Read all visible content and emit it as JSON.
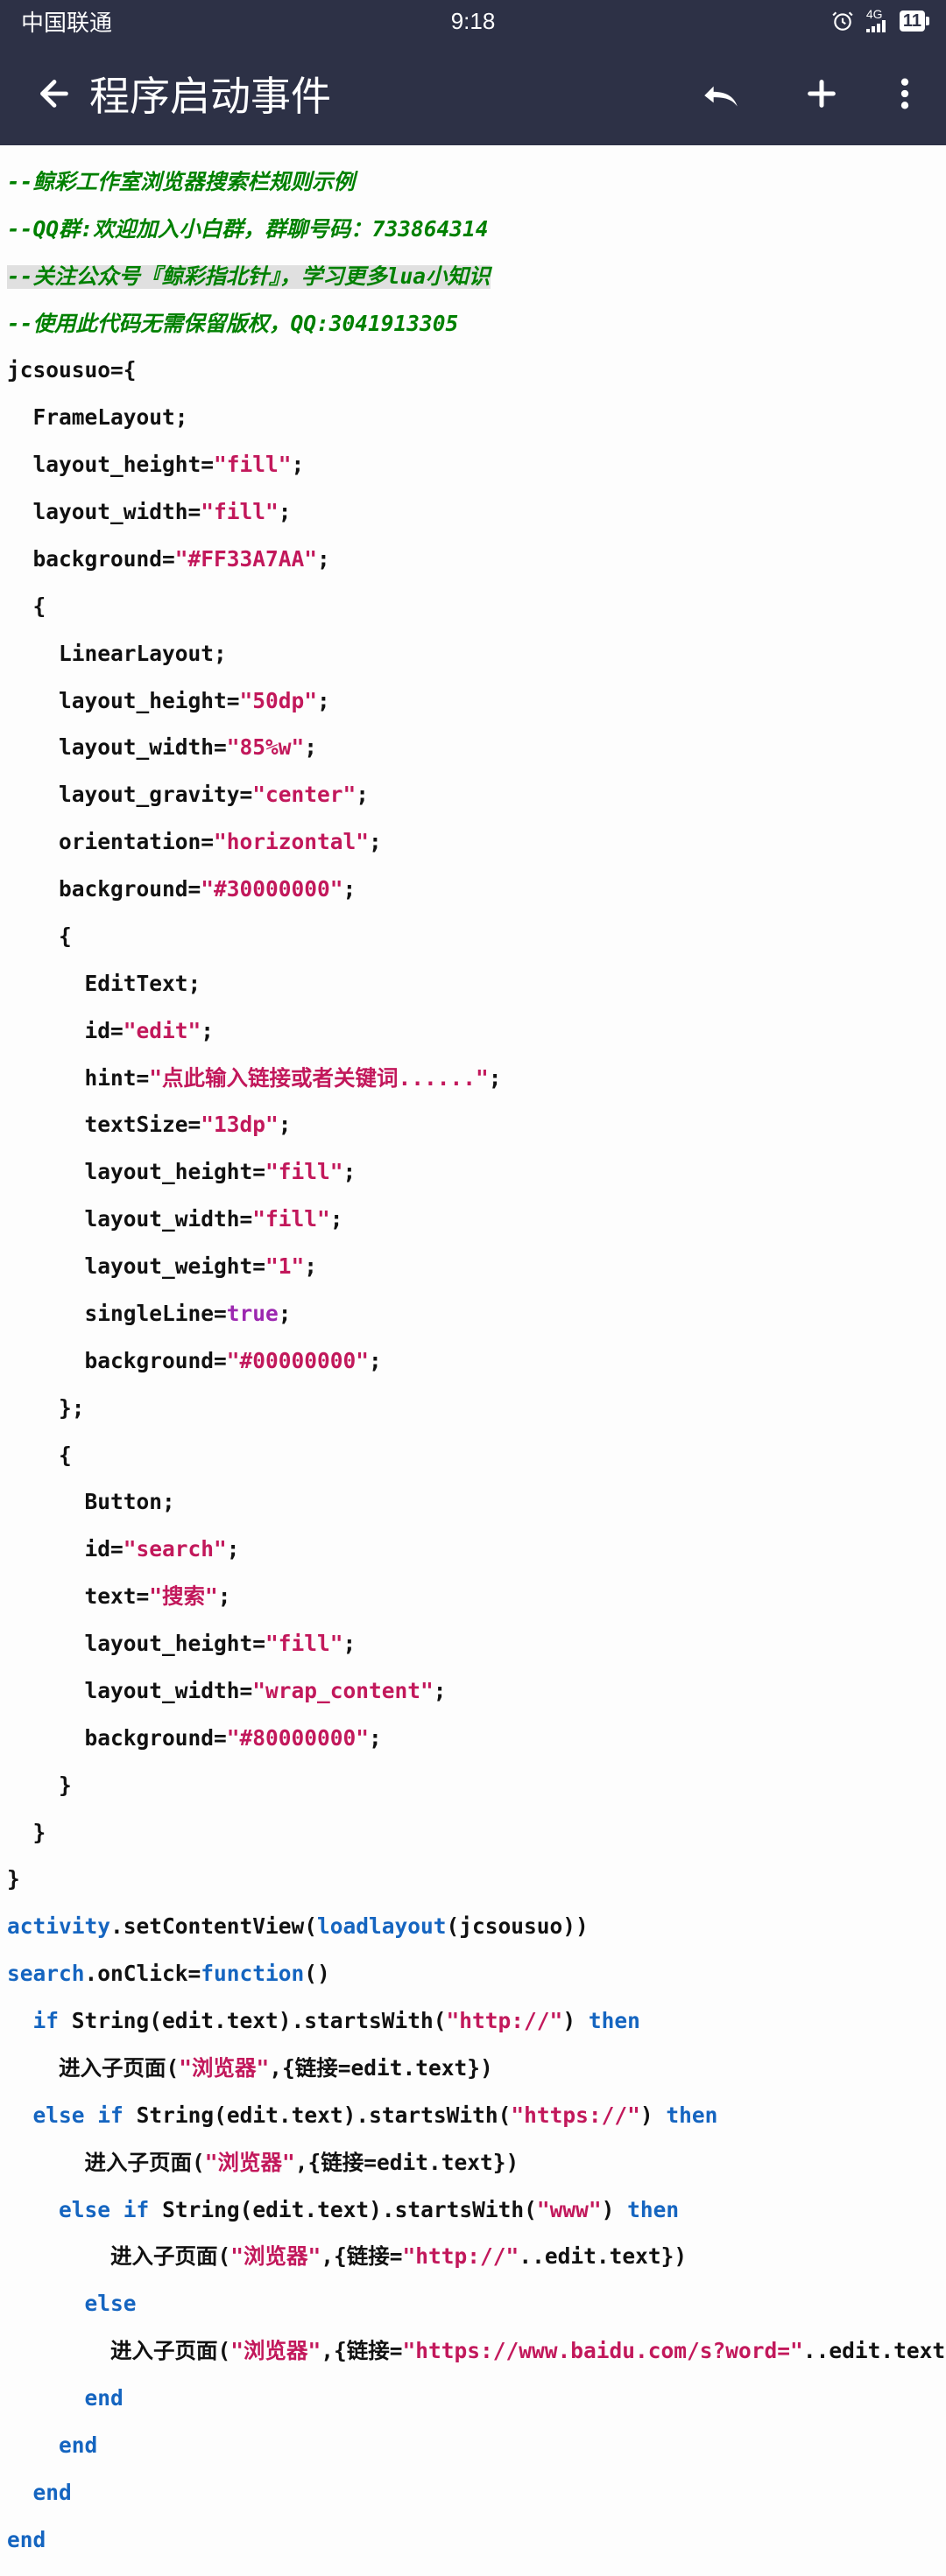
{
  "status": {
    "carrier": "中国联通",
    "time": "9:18",
    "network": "4G",
    "battery": "11"
  },
  "appbar": {
    "title": "程序启动事件"
  },
  "code": {
    "c1": "--鲸彩工作室浏览器搜索栏规则示例",
    "c2": "--QQ群:欢迎加入小白群，群聊号码：733864314",
    "c3": "--关注公众号『鲸彩指北针』，学习更多lua小知识",
    "c4": "--使用此代码无需保留版权，QQ:3041913305",
    "l1a": "jcsousuo={",
    "l2": "  FrameLayout;",
    "l3a": "  layout_height=",
    "l3b": "\"fill\"",
    "l3c": ";",
    "l4a": "  layout_width=",
    "l4b": "\"fill\"",
    "l4c": ";",
    "l5a": "  background=",
    "l5b": "\"#FF33A7AA\"",
    "l5c": ";",
    "l6": "  {",
    "l7": "    LinearLayout;",
    "l8a": "    layout_height=",
    "l8b": "\"50dp\"",
    "l8c": ";",
    "l9a": "    layout_width=",
    "l9b": "\"85%w\"",
    "l9c": ";",
    "l10a": "    layout_gravity=",
    "l10b": "\"center\"",
    "l10c": ";",
    "l11a": "    orientation=",
    "l11b": "\"horizontal\"",
    "l11c": ";",
    "l12a": "    background=",
    "l12b": "\"#30000000\"",
    "l12c": ";",
    "l13": "    {",
    "l14": "      EditText;",
    "l15a": "      id=",
    "l15b": "\"edit\"",
    "l15c": ";",
    "l16a": "      hint=",
    "l16b": "\"点此输入链接或者关键词......\"",
    "l16c": ";",
    "l17a": "      textSize=",
    "l17b": "\"13dp\"",
    "l17c": ";",
    "l18a": "      layout_height=",
    "l18b": "\"fill\"",
    "l18c": ";",
    "l19a": "      layout_width=",
    "l19b": "\"fill\"",
    "l19c": ";",
    "l20a": "      layout_weight=",
    "l20b": "\"1\"",
    "l20c": ";",
    "l21a": "      singleLine=",
    "l21b": "true",
    "l21c": ";",
    "l22a": "      background=",
    "l22b": "\"#00000000\"",
    "l22c": ";",
    "l23": "    };",
    "l24": "    {",
    "l25": "      Button;",
    "l26a": "      id=",
    "l26b": "\"search\"",
    "l26c": ";",
    "l27a": "      text=",
    "l27b": "\"搜索\"",
    "l27c": ";",
    "l28a": "      layout_height=",
    "l28b": "\"fill\"",
    "l28c": ";",
    "l29a": "      layout_width=",
    "l29b": "\"wrap_content\"",
    "l29c": ";",
    "l30a": "      background=",
    "l30b": "\"#80000000\"",
    "l30c": ";",
    "l31": "    }",
    "l32": "  }",
    "l33": "}",
    "l34a": "activity",
    "l34b": ".setContentView(",
    "l34c": "loadlayout",
    "l34d": "(jcsousuo))",
    "l35a": "search",
    "l35b": ".onClick=",
    "l35c": "function",
    "l35d": "()",
    "l36a": "  ",
    "l36b": "if",
    "l36c": " String(edit.text).startsWith(",
    "l36d": "\"http://\"",
    "l36e": ") ",
    "l36f": "then",
    "l37a": "    进入子页面(",
    "l37b": "\"浏览器\"",
    "l37c": ",{链接=edit.text})",
    "l38a": "  ",
    "l38b": "else",
    "l38c": " ",
    "l38d": "if",
    "l38e": " String(edit.text).startsWith(",
    "l38f": "\"https://\"",
    "l38g": ") ",
    "l38h": "then",
    "l39a": "      进入子页面(",
    "l39b": "\"浏览器\"",
    "l39c": ",{链接=edit.text})",
    "l40a": "    ",
    "l40b": "else",
    "l40c": " ",
    "l40d": "if",
    "l40e": " String(edit.text).startsWith(",
    "l40f": "\"www\"",
    "l40g": ") ",
    "l40h": "then",
    "l41a": "        进入子页面(",
    "l41b": "\"浏览器\"",
    "l41c": ",{链接=",
    "l41d": "\"http://\"",
    "l41e": "..edit.text})",
    "l42a": "      ",
    "l42b": "else",
    "l43a": "        进入子页面(",
    "l43b": "\"浏览器\"",
    "l43c": ",{链接=",
    "l43d": "\"https://www.baidu.com/s?word=\"",
    "l43e": "..edit.text})",
    "l44a": "      ",
    "l44b": "end",
    "l45a": "    ",
    "l45b": "end",
    "l46a": "  ",
    "l46b": "end",
    "l47": "end"
  }
}
